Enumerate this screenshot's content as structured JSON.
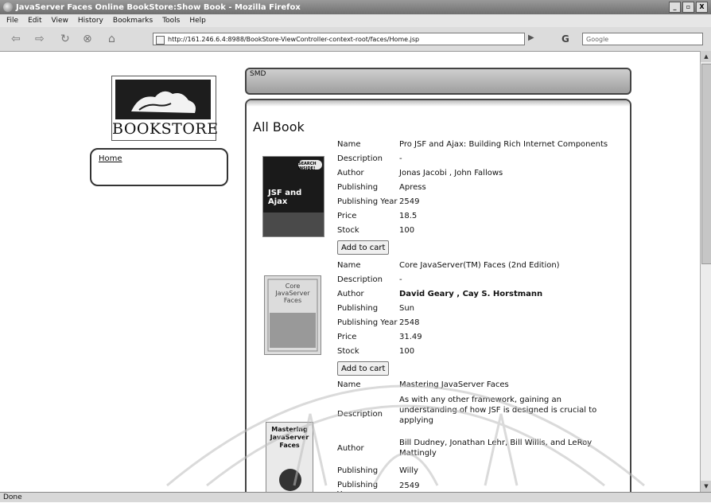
{
  "window": {
    "title": "JavaServer Faces Online BookStore:Show Book - Mozilla Firefox",
    "controls": [
      "_",
      "▫",
      "X"
    ]
  },
  "menu": [
    "File",
    "Edit",
    "View",
    "History",
    "Bookmarks",
    "Tools",
    "Help"
  ],
  "nav": {
    "url": "http://161.246.6.4:8988/BookStore-ViewController-context-root/faces/Home.jsp",
    "search_engine": "G",
    "search_placeholder": "Google"
  },
  "sidebar": {
    "logo_text": "BOOKSTORE",
    "home_link": "Home"
  },
  "top_panel_label": "SMD",
  "main": {
    "heading": "All Book",
    "labels": {
      "name": "Name",
      "description": "Description",
      "author": "Author",
      "publishing": "Publishing",
      "publishing_year": "Publishing Year",
      "price": "Price",
      "stock": "Stock",
      "publishing_year_wrapped": "Publishing Year"
    },
    "add_to_cart": "Add to cart",
    "books": [
      {
        "cover_text": "JSF and Ajax",
        "cover_badge": "SEARCH INSIDE!",
        "name": "Pro JSF and Ajax: Building Rich Internet Components",
        "description": "-",
        "author": "Jonas Jacobi , John Fallows",
        "publishing": "Apress",
        "publishing_year": "2549",
        "price": "18.5",
        "stock": "100"
      },
      {
        "cover_text": "Core JavaServer Faces",
        "name": "Core JavaServer(TM) Faces (2nd Edition)",
        "description": "-",
        "author": "David Geary , Cay S. Horstmann",
        "publishing": "Sun",
        "publishing_year": "2548",
        "price": "31.49",
        "stock": "100"
      },
      {
        "cover_text": "Mastering JavaServer Faces",
        "name": "Mastering JavaServer Faces",
        "description": "As with any other framework, gaining an understanding of how JSF is designed is crucial to applying",
        "author": "Bill Dudney, Jonathan Lehr, Bill Willis, and LeRoy Mattingly",
        "publishing": "Willy",
        "publishing_year": "2549"
      }
    ]
  },
  "status": "Done"
}
